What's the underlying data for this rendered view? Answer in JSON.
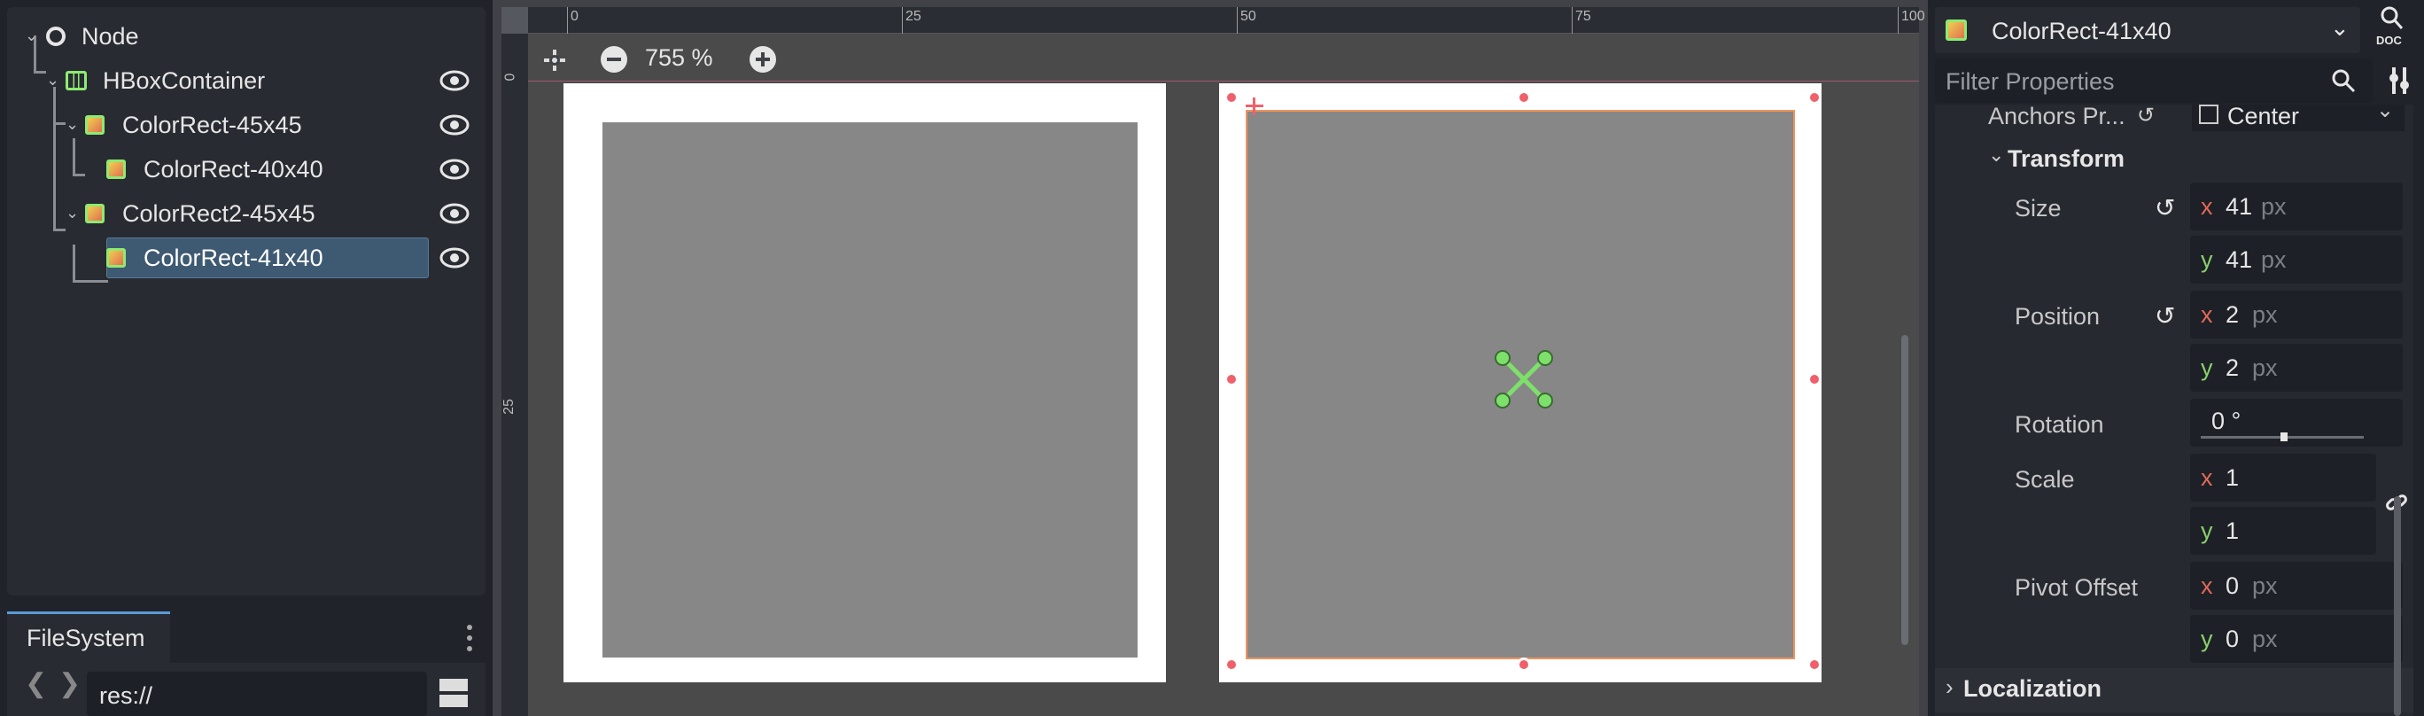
{
  "scene_tree": {
    "items": [
      {
        "label": "Node"
      },
      {
        "label": "HBoxContainer"
      },
      {
        "label": "ColorRect-45x45"
      },
      {
        "label": "ColorRect-40x40"
      },
      {
        "label": "ColorRect2-45x45"
      },
      {
        "label": "ColorRect-41x40"
      }
    ]
  },
  "filesystem": {
    "tab_label": "FileSystem",
    "path": "res://"
  },
  "canvas": {
    "zoom_label": "755 %",
    "ruler_top_ticks": [
      "0",
      "25",
      "50",
      "75",
      "100"
    ],
    "ruler_left_ticks": [
      "0",
      "25"
    ]
  },
  "inspector": {
    "node_name": "ColorRect-41x40",
    "doc_label": "DOC",
    "filter_placeholder": "Filter Properties",
    "anchors_label": "Anchors Pr...",
    "anchors_value": "Center",
    "transform_section": "Transform",
    "size": {
      "label": "Size",
      "x": "41",
      "y": "41",
      "unit": "px",
      "x_axis": "x",
      "y_axis": "y"
    },
    "position": {
      "label": "Position",
      "x": "2",
      "y": "2",
      "unit": "px",
      "x_axis": "x",
      "y_axis": "y"
    },
    "rotation": {
      "label": "Rotation",
      "value": "0 °",
      "slider_fraction": 0.5
    },
    "scale": {
      "label": "Scale",
      "x": "1",
      "y": "1",
      "x_axis": "x",
      "y_axis": "y"
    },
    "pivot_offset": {
      "label": "Pivot Offset",
      "x": "0",
      "y": "0",
      "unit": "px",
      "x_axis": "x",
      "y_axis": "y"
    },
    "localization_section": "Localization"
  },
  "colors": {
    "accent": "#5a9ad8",
    "selection": "#3e5a72",
    "x_axis": "#e06a5a",
    "y_axis": "#8ccf6e",
    "handle": "#f0606a"
  }
}
